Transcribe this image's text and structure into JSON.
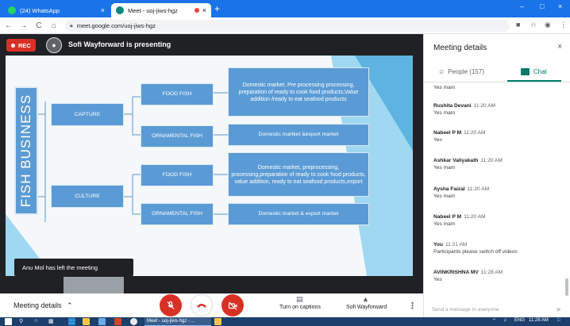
{
  "browser": {
    "tabs": [
      {
        "label": "(24) WhatsApp",
        "favicon_color": "#25d366",
        "close": "×"
      },
      {
        "label": "Meet - uoj-jiws-hgz",
        "favicon_color": "#00897b",
        "close": "×"
      }
    ],
    "new_tab": "+",
    "window_controls": {
      "minimize": "–",
      "maximize": "□",
      "close": "×"
    },
    "nav": {
      "back": "←",
      "forward": "→",
      "reload": "C",
      "home": "⌂"
    },
    "url": "meet.google.com/uoj-jiws-hgz",
    "toolbar_icons": [
      "camera-icon",
      "star-icon",
      "account-icon",
      "menu-icon"
    ]
  },
  "meet": {
    "rec_label": "REC",
    "presenter_text": "Sofi Wayforward is presenting",
    "toast": "Anu Mol has left the meeting",
    "bottom": {
      "meeting_details": "Meeting details",
      "captions_label": "Turn on captions",
      "presenter_label": "Sofi Wayforward"
    }
  },
  "slide": {
    "title": "FISH BUSINESS",
    "nodes": {
      "capture": "CAPTURE",
      "culture": "CULTURE",
      "food_fish_1": "FOOD FISH",
      "ornamental_1": "ORNAMENTAL FISH",
      "food_fish_2": "FOOD FISH",
      "ornamental_2": "ORNAMENTAL FISH",
      "capture_food_desc": "Domestic market, Pre processing processing, preparation of ready to cook food products,Value addition /ready to eat seafood products",
      "capture_orn_desc": "Domestic martket &export market",
      "culture_food_desc": "Domestic market, preprocessing, processing,preparation of ready to cook food products, value addition, ready to eat seafood products,export",
      "culture_orn_desc": "Domestic market & export market"
    }
  },
  "panel": {
    "title": "Meeting details",
    "close": "×",
    "tabs": {
      "people": "People (157)",
      "chat": "Chat"
    },
    "messages": [
      {
        "name": "",
        "time": "",
        "text": "Yes mam"
      },
      {
        "name": "Rushita Devani",
        "time": "11:20 AM",
        "text": "Yes mam"
      },
      {
        "name": "Nabeel P M",
        "time": "11:20 AM",
        "text": "Yes"
      },
      {
        "name": "Ashkar Valiyakath",
        "time": "11:20 AM",
        "text": "Yes mam"
      },
      {
        "name": "Aysha Faizal",
        "time": "11:20 AM",
        "text": "Yes mam"
      },
      {
        "name": "Nabeel P M",
        "time": "11:20 AM",
        "text": "Yes mam"
      },
      {
        "name": "You",
        "time": "11:21 AM",
        "text": "Participants please switch off videos"
      },
      {
        "name": "AVINKRISHNA MV",
        "time": "11:28 AM",
        "text": "Yes"
      }
    ],
    "send_placeholder": "Send a message to everyone"
  },
  "taskbar": {
    "task_label": "Meet - uoj-jiws-hgz - ...",
    "language": "ENG",
    "time": "11:28 AM"
  },
  "colors": {
    "chrome_blue": "#1a73e8",
    "meet_red": "#d93025",
    "chat_green": "#00796b",
    "slide_box": "#5b9bd5",
    "slide_stripe": "#9fd8f0",
    "taskbar": "#1c3f6b"
  }
}
